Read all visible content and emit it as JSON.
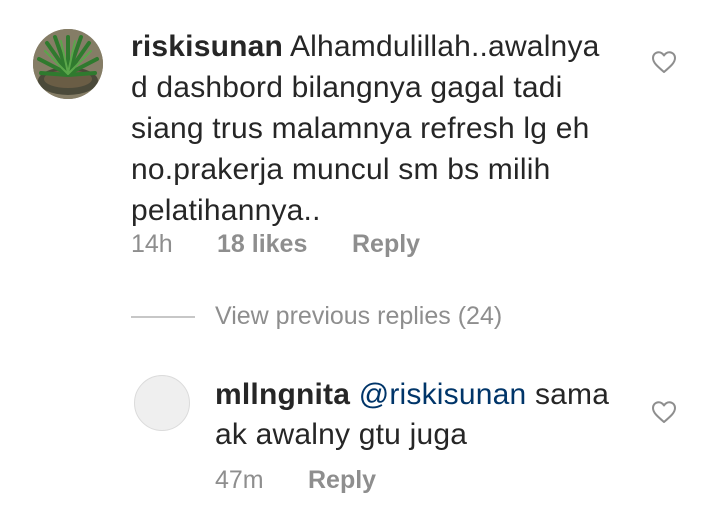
{
  "comment": {
    "username": "riskisunan",
    "text": "Alhamdulillah..awalnya d dashbord bilangnya gagal tadi siang trus malamnya refresh lg eh no.prakerja muncul sm bs milih pelatihannya..",
    "time": "14h",
    "likes": "18 likes",
    "reply_label": "Reply",
    "like_icon": "heart-outline-icon"
  },
  "view_previous": {
    "label": "View previous replies (24)"
  },
  "reply": {
    "username": "mllngnita",
    "mention": "@riskisunan",
    "text": "sama ak awalny gtu juga",
    "time": "47m",
    "reply_label": "Reply",
    "like_icon": "heart-outline-icon"
  },
  "colors": {
    "text": "#262626",
    "secondary": "#8e8e8e",
    "mention": "#003569"
  }
}
